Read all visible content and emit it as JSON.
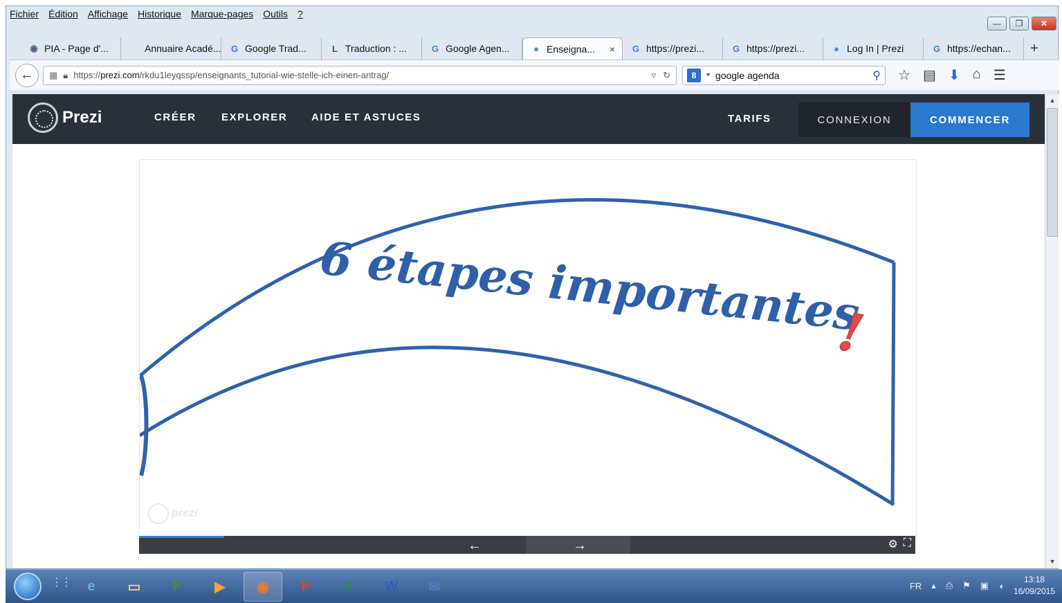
{
  "menu": [
    "Fichier",
    "Édition",
    "Affichage",
    "Historique",
    "Marque-pages",
    "Outils",
    "?"
  ],
  "tabs": [
    {
      "label": "PIA - Page d'...",
      "icon": "globe-icon",
      "fav": "◉",
      "fav_color": "#4b5d7a"
    },
    {
      "label": "Annuaire Acadé...",
      "icon": "blank-page-icon",
      "fav": "",
      "fav_color": "#888888"
    },
    {
      "label": "Google Trad...",
      "icon": "translate-icon",
      "fav": "G",
      "fav_color": "#3a78d8"
    },
    {
      "label": "Traduction : ...",
      "icon": "letter-l-icon",
      "fav": "L",
      "fav_color": "#1f4f9c"
    },
    {
      "label": "Google Agen...",
      "icon": "google-icon",
      "fav": "G",
      "fav_color": "#3b7de0"
    },
    {
      "label": "Enseigna...",
      "icon": "prezi-icon",
      "fav": "●",
      "fav_color": "#3e8ee8",
      "active": true
    },
    {
      "label": "https://prezi...",
      "icon": "google-icon",
      "fav": "G",
      "fav_color": "#3b7de0"
    },
    {
      "label": "https://prezi...",
      "icon": "google-icon",
      "fav": "G",
      "fav_color": "#3b7de0"
    },
    {
      "label": "Log In | Prezi",
      "icon": "prezi-icon",
      "fav": "●",
      "fav_color": "#3e8ee8"
    },
    {
      "label": "https://echan...",
      "icon": "google-icon",
      "fav": "G",
      "fav_color": "#3b7de0"
    }
  ],
  "address": {
    "prefix": "https://",
    "host": "prezi.com",
    "path": "/rkdu1leyqssp/enseignants_tutorial-wie-stelle-ich-einen-antrag/"
  },
  "search": {
    "value": "google agenda",
    "engine": "8"
  },
  "site": {
    "logo": "Prezi",
    "nav": [
      "CRÉER",
      "EXPLORER",
      "AIDE ET ASTUCES"
    ],
    "tarifs": "TARIFS",
    "connexion": "CONNEXION",
    "commencer": "COMMENCER"
  },
  "slide": {
    "title": "6 étapes importantes",
    "exclaim": "!",
    "title_color": "#2f5fa8",
    "exclaim_color": "#e04a4a",
    "watermark": "prezi",
    "progress": 0.11
  },
  "taskbar": {
    "apps": [
      {
        "name": "ie",
        "glyph": "e",
        "color": "#5fb2ec"
      },
      {
        "name": "explorer",
        "glyph": "▭",
        "color": "#f2cf6a"
      },
      {
        "name": "project",
        "glyph": "P",
        "color": "#4b8d3d"
      },
      {
        "name": "media",
        "glyph": "▶",
        "color": "#f2a23a"
      },
      {
        "name": "firefox",
        "glyph": "◉",
        "color": "#f07a28",
        "on": true
      },
      {
        "name": "powerpoint",
        "glyph": "P",
        "color": "#d54a2a"
      },
      {
        "name": "excel",
        "glyph": "X",
        "color": "#2d8a47"
      },
      {
        "name": "word",
        "glyph": "W",
        "color": "#2b5fb3"
      },
      {
        "name": "thunderbird",
        "glyph": "✉",
        "color": "#4d7fc4"
      }
    ],
    "lang": "FR",
    "time": "13:18",
    "date": "16/09/2015"
  }
}
